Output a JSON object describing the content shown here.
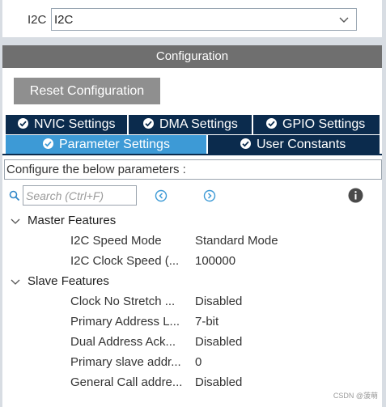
{
  "mode": {
    "label": "I2C",
    "selected": "I2C"
  },
  "config_bar": {
    "title": "Configuration"
  },
  "reset_button": {
    "label": "Reset Configuration"
  },
  "tabs": {
    "row1": [
      {
        "label": "NVIC Settings"
      },
      {
        "label": "DMA Settings"
      },
      {
        "label": "GPIO Settings"
      }
    ],
    "row2": [
      {
        "label": "Parameter Settings",
        "active": true
      },
      {
        "label": "User Constants",
        "active": false
      }
    ]
  },
  "instructions": "Configure the below parameters :",
  "search": {
    "placeholder": "Search (Ctrl+F)",
    "value": ""
  },
  "groups": [
    {
      "label": "Master Features",
      "params": [
        {
          "name": "I2C Speed Mode",
          "value": "Standard Mode"
        },
        {
          "name": "I2C Clock Speed (...",
          "value": "100000"
        }
      ]
    },
    {
      "label": "Slave Features",
      "params": [
        {
          "name": "Clock No Stretch ...",
          "value": "Disabled"
        },
        {
          "name": "Primary Address L...",
          "value": "7-bit"
        },
        {
          "name": "Dual Address Ack...",
          "value": "Disabled"
        },
        {
          "name": "Primary slave addr...",
          "value": "0"
        },
        {
          "name": "General Call addre...",
          "value": "Disabled"
        }
      ]
    }
  ],
  "watermark": "CSDN @菠萌",
  "colors": {
    "tab_dark": "#0b2b4d",
    "tab_active": "#3d9ad6",
    "config_bar": "#6f6f6f",
    "reset_button": "#8f8f8f",
    "accent_icon": "#3d9ad6"
  }
}
